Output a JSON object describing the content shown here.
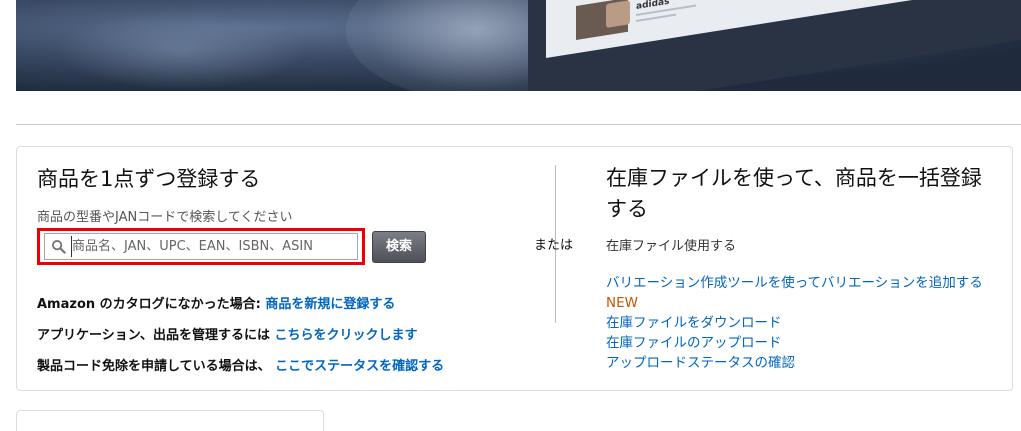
{
  "hero": {
    "brand": "adidas"
  },
  "single": {
    "title": "商品を1点ずつ登録する",
    "hint": "商品の型番やJANコードで検索してください",
    "search_placeholder": "商品名、JAN、UPC、EAN、ISBN、ASIN",
    "search_value": "",
    "search_button": "検索",
    "rows": [
      {
        "prefix": "Amazon のカタログになかった場合: ",
        "link": "商品を新規に登録する"
      },
      {
        "prefix": "アプリケーション、出品を管理するには ",
        "link": "こちらをクリックします"
      },
      {
        "prefix": "製品コード免除を申請している場合は、 ",
        "link": "ここでステータスを確認する"
      }
    ]
  },
  "or_label": "または",
  "bulk": {
    "title": "在庫ファイルを使って、商品を一括登録する",
    "subtitle": "在庫ファイル使用する",
    "links": [
      {
        "label": "バリエーション作成ツールを使ってバリエーションを追加する",
        "badge": "NEW"
      },
      {
        "label": "在庫ファイルをダウンロード"
      },
      {
        "label": "在庫ファイルのアップロード"
      },
      {
        "label": "アップロードステータスの確認"
      }
    ]
  },
  "colors": {
    "link": "#0066c0",
    "badge": "#c45500",
    "highlight": "#e00000",
    "button": "#5a5e64"
  },
  "icons": [
    "search-icon"
  ]
}
